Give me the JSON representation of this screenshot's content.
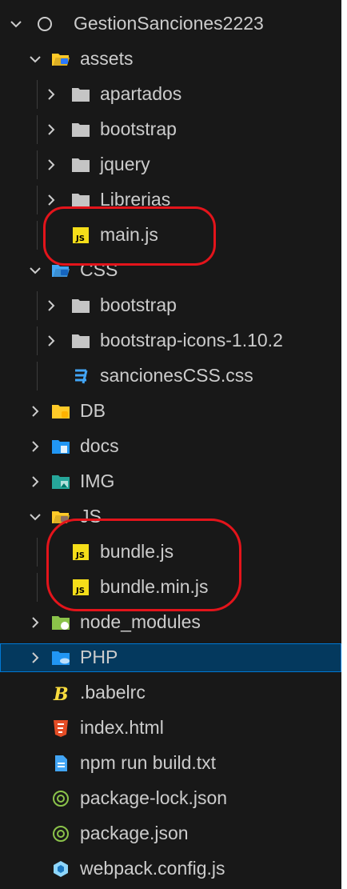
{
  "explorer": {
    "root": {
      "label": "GestionSanciones2223"
    },
    "items": [
      {
        "label": "assets",
        "icon": "folder-assets-open-icon",
        "type": "folder",
        "expanded": true
      },
      {
        "label": "apartados",
        "icon": "folder-icon",
        "type": "folder",
        "expanded": false
      },
      {
        "label": "bootstrap",
        "icon": "folder-icon",
        "type": "folder",
        "expanded": false
      },
      {
        "label": "jquery",
        "icon": "folder-icon",
        "type": "folder",
        "expanded": false
      },
      {
        "label": "Librerias",
        "icon": "folder-icon",
        "type": "folder",
        "expanded": false
      },
      {
        "label": "main.js",
        "icon": "js-file-icon",
        "type": "file"
      },
      {
        "label": "CSS",
        "icon": "folder-css-open-icon",
        "type": "folder",
        "expanded": true
      },
      {
        "label": "bootstrap",
        "icon": "folder-icon",
        "type": "folder",
        "expanded": false
      },
      {
        "label": "bootstrap-icons-1.10.2",
        "icon": "folder-icon",
        "type": "folder",
        "expanded": false
      },
      {
        "label": "sancionesCSS.css",
        "icon": "css-file-icon",
        "type": "file"
      },
      {
        "label": "DB",
        "icon": "folder-db-icon",
        "type": "folder",
        "expanded": false
      },
      {
        "label": "docs",
        "icon": "folder-docs-icon",
        "type": "folder",
        "expanded": false
      },
      {
        "label": "IMG",
        "icon": "folder-images-icon",
        "type": "folder",
        "expanded": false
      },
      {
        "label": "JS",
        "icon": "folder-js-open-icon",
        "type": "folder",
        "expanded": true
      },
      {
        "label": "bundle.js",
        "icon": "js-file-icon",
        "type": "file"
      },
      {
        "label": "bundle.min.js",
        "icon": "js-file-icon",
        "type": "file"
      },
      {
        "label": "node_modules",
        "icon": "folder-node-icon",
        "type": "folder",
        "expanded": false
      },
      {
        "label": "PHP",
        "icon": "folder-php-icon",
        "type": "folder",
        "expanded": false,
        "selected": true
      },
      {
        "label": ".babelrc",
        "icon": "babel-file-icon",
        "type": "file"
      },
      {
        "label": "index.html",
        "icon": "html-file-icon",
        "type": "file"
      },
      {
        "label": "npm run build.txt",
        "icon": "text-file-icon",
        "type": "file"
      },
      {
        "label": "package-lock.json",
        "icon": "npm-json-file-icon",
        "type": "file"
      },
      {
        "label": "package.json",
        "icon": "npm-json-file-icon",
        "type": "file"
      },
      {
        "label": "webpack.config.js",
        "icon": "webpack-file-icon",
        "type": "file"
      }
    ]
  },
  "colors": {
    "background": "#181818",
    "text": "#cccccc",
    "selection": "#04395e",
    "selection_border": "#0078d4",
    "annotation": "#e3141b",
    "js": "#f5de19",
    "css": "#42a5f5",
    "html": "#e44d26",
    "babel": "#f9dc3e",
    "npm": "#8bc34a"
  }
}
